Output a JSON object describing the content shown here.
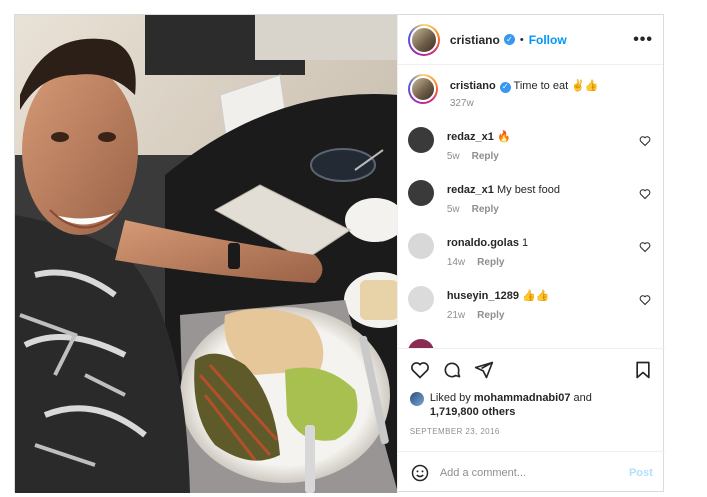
{
  "header": {
    "username": "cristiano",
    "separator": "•",
    "follow_label": "Follow",
    "more_label": "•••"
  },
  "caption": {
    "username": "cristiano",
    "text": "Time to eat ✌️👍",
    "time": "327w"
  },
  "comments": [
    {
      "username": "redaz_x1",
      "text": "🔥",
      "time": "5w",
      "reply": "Reply",
      "avatar_color": "#3a3a3a"
    },
    {
      "username": "redaz_x1",
      "text": "My best food",
      "time": "5w",
      "reply": "Reply",
      "avatar_color": "#3a3a3a"
    },
    {
      "username": "ronaldo.golas",
      "text": "1",
      "time": "14w",
      "reply": "Reply",
      "avatar_color": "#d8d8d8"
    },
    {
      "username": "huseyin_1289",
      "text": "👍👍",
      "time": "21w",
      "reply": "Reply",
      "avatar_color": "#dbdbdb"
    },
    {
      "username": "",
      "text": "",
      "time": "",
      "reply": "",
      "avatar_color": "#8b2a52"
    }
  ],
  "likes": {
    "prefix": "Liked by",
    "user": "mohammadnabi07",
    "middle": "and",
    "count": "1,719,800 others"
  },
  "date": "SEPTEMBER 23, 2016",
  "add_comment": {
    "placeholder": "Add a comment...",
    "post_label": "Post"
  },
  "colors": {
    "accent": "#0095f6",
    "verified": "#3897f0",
    "post_disabled": "#b2dffc"
  }
}
